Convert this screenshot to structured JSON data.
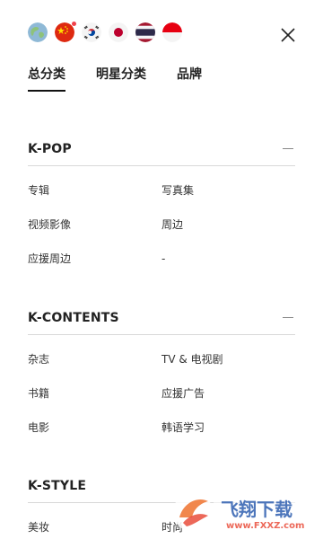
{
  "flags": [
    {
      "icon": "globe-icon"
    },
    {
      "icon": "china-flag-icon",
      "badge": true
    },
    {
      "icon": "korea-flag-icon"
    },
    {
      "icon": "japan-flag-icon"
    },
    {
      "icon": "thailand-flag-icon"
    },
    {
      "icon": "indonesia-flag-icon"
    }
  ],
  "close_icon": "close-icon",
  "tabs": [
    {
      "label": "总分类",
      "active": true
    },
    {
      "label": "明星分类",
      "active": false
    },
    {
      "label": "品牌",
      "active": false
    }
  ],
  "sections": [
    {
      "title": "K-POP",
      "items": [
        "专辑",
        "写真集",
        "视频影像",
        "周边",
        "应援周边",
        "-"
      ]
    },
    {
      "title": "K-CONTENTS",
      "items": [
        "杂志",
        "TV & 电视剧",
        "书籍",
        "应援广告",
        "电影",
        "韩语学习"
      ]
    },
    {
      "title": "K-STYLE",
      "items": [
        "美妆",
        "时尚"
      ]
    }
  ],
  "watermark": {
    "main": "飞翔下载",
    "url": "www.FXXZ.com"
  },
  "colors": {
    "accent_red": "#f0414a",
    "divider": "#d8d8d8"
  }
}
